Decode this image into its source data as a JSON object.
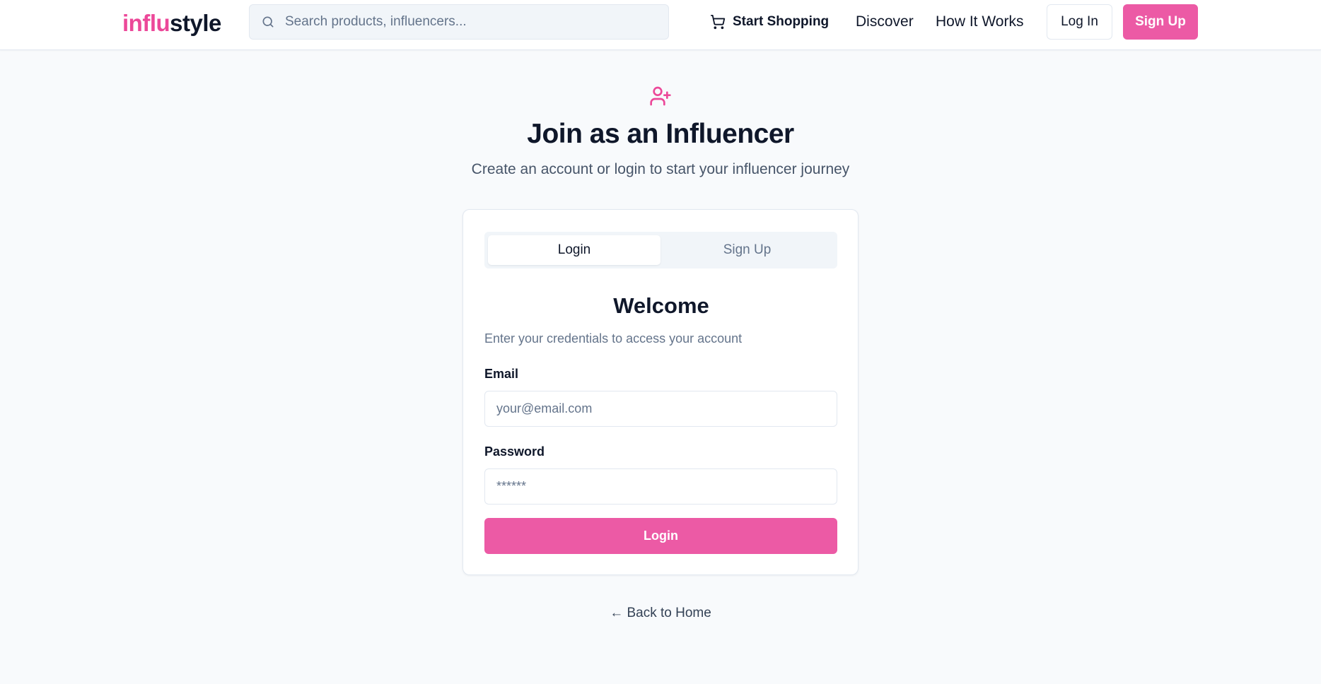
{
  "header": {
    "logo_part1": "influ",
    "logo_part2": "style",
    "search_placeholder": "Search products, influencers...",
    "start_shopping": "Start Shopping",
    "nav": {
      "discover": "Discover",
      "how_it_works": "How It Works"
    },
    "login_label": "Log In",
    "signup_label": "Sign Up"
  },
  "hero": {
    "title": "Join as an Influencer",
    "subtitle": "Create an account or login to start your influencer journey"
  },
  "auth": {
    "tabs": {
      "login": "Login",
      "signup": "Sign Up"
    },
    "active_tab": "login",
    "welcome": "Welcome",
    "description": "Enter your credentials to access your account",
    "email_label": "Email",
    "email_placeholder": "your@email.com",
    "password_label": "Password",
    "password_placeholder": "******",
    "submit_label": "Login"
  },
  "back_link": "← Back to Home",
  "colors": {
    "accent": "#ec4899",
    "button": "#ec5aa5",
    "text": "#0f172a",
    "muted": "#64748b",
    "background": "#f8fafc"
  },
  "icons": {
    "search": "search-icon",
    "cart": "shopping-cart-icon",
    "hero": "user-plus-icon"
  }
}
